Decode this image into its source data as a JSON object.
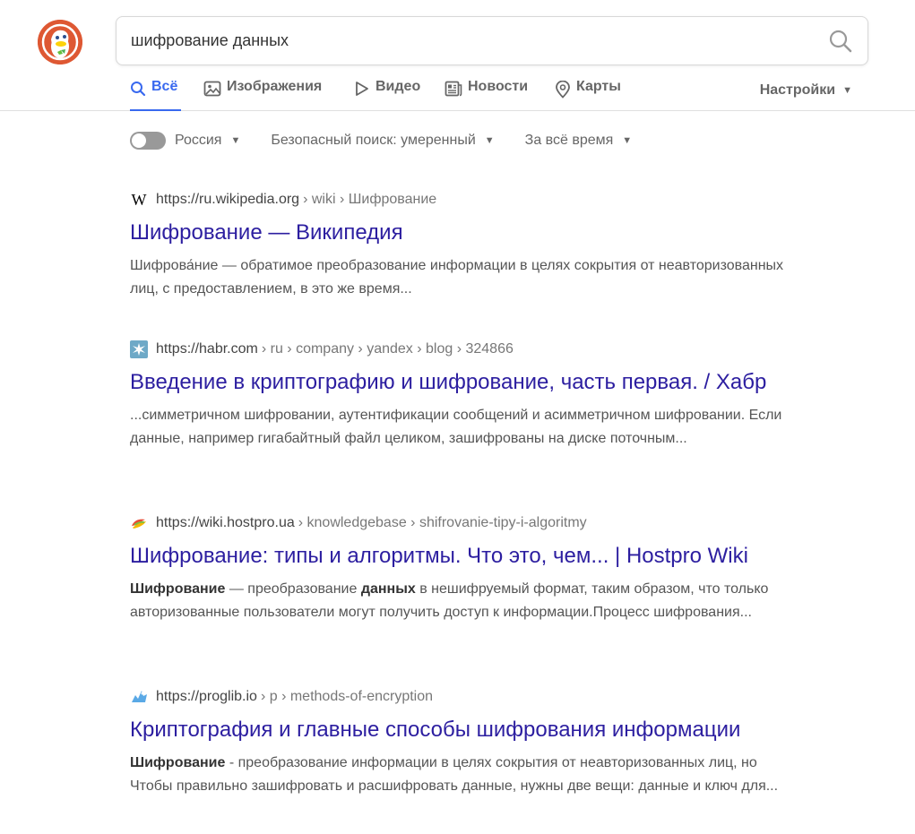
{
  "search": {
    "query": "шифрование данных"
  },
  "tabs": [
    {
      "label": "Всё",
      "icon": "search-icon"
    },
    {
      "label": "Изображения",
      "icon": "image-icon"
    },
    {
      "label": "Видео",
      "icon": "play-icon"
    },
    {
      "label": "Новости",
      "icon": "newspaper-icon"
    },
    {
      "label": "Карты",
      "icon": "map-pin-icon"
    }
  ],
  "settings_label": "Настройки",
  "filters": {
    "region": "Россия",
    "safe_search": "Безопасный поиск: умеренный",
    "time": "За всё время"
  },
  "colors": {
    "accent": "#3969ef",
    "title_link": "#2c1ea0",
    "logo": "#de5833"
  },
  "results": [
    {
      "favicon": "wikipedia-icon",
      "domain": "https://ru.wikipedia.org",
      "path": "› wiki › Шифрование",
      "title": "Шифрование — Википедия",
      "snippet": [
        {
          "t": "Шифрова́ние — обратимое преобразование информации в целях сокрытия от неавторизованных лиц, с предоставлением, в это же время...",
          "b": false
        }
      ]
    },
    {
      "favicon": "habr-icon",
      "domain": "https://habr.com",
      "path": "› ru › company › yandex › blog › 324866",
      "title": "Введение в криптографию и шифрование, часть первая. / Хабр",
      "snippet": [
        {
          "t": "...симметричном шифровании, аутентификации сообщений и асимметричном шифровании. Если данные, например гигабайтный файл целиком, зашифрованы на диске поточным...",
          "b": false
        }
      ]
    },
    {
      "favicon": "hostpro-icon",
      "domain": "https://wiki.hostpro.ua",
      "path": "› knowledgebase › shifrovanie-tipy-i-algoritmy",
      "title": "Шифрование: типы и алгоритмы. Что это, чем... | Hostpro Wiki",
      "snippet": [
        {
          "t": "Шифрование",
          "b": true
        },
        {
          "t": " — преобразование ",
          "b": false
        },
        {
          "t": "данных",
          "b": true
        },
        {
          "t": " в нешифруемый формат, таким образом, что только авторизованные пользователи могут получить доступ к информации.Процесс шифрования...",
          "b": false
        }
      ]
    },
    {
      "favicon": "proglib-icon",
      "domain": "https://proglib.io",
      "path": "› p › methods-of-encryption",
      "title": "Криптография и главные способы шифрования информации",
      "snippet": [
        {
          "t": "Шифрование",
          "b": true
        },
        {
          "t": " - преобразование информации в целях сокрытия от неавторизованных лиц, но Чтобы правильно зашифровать и расшифровать данные, нужны две вещи: данные и ключ для...",
          "b": false
        }
      ]
    }
  ]
}
